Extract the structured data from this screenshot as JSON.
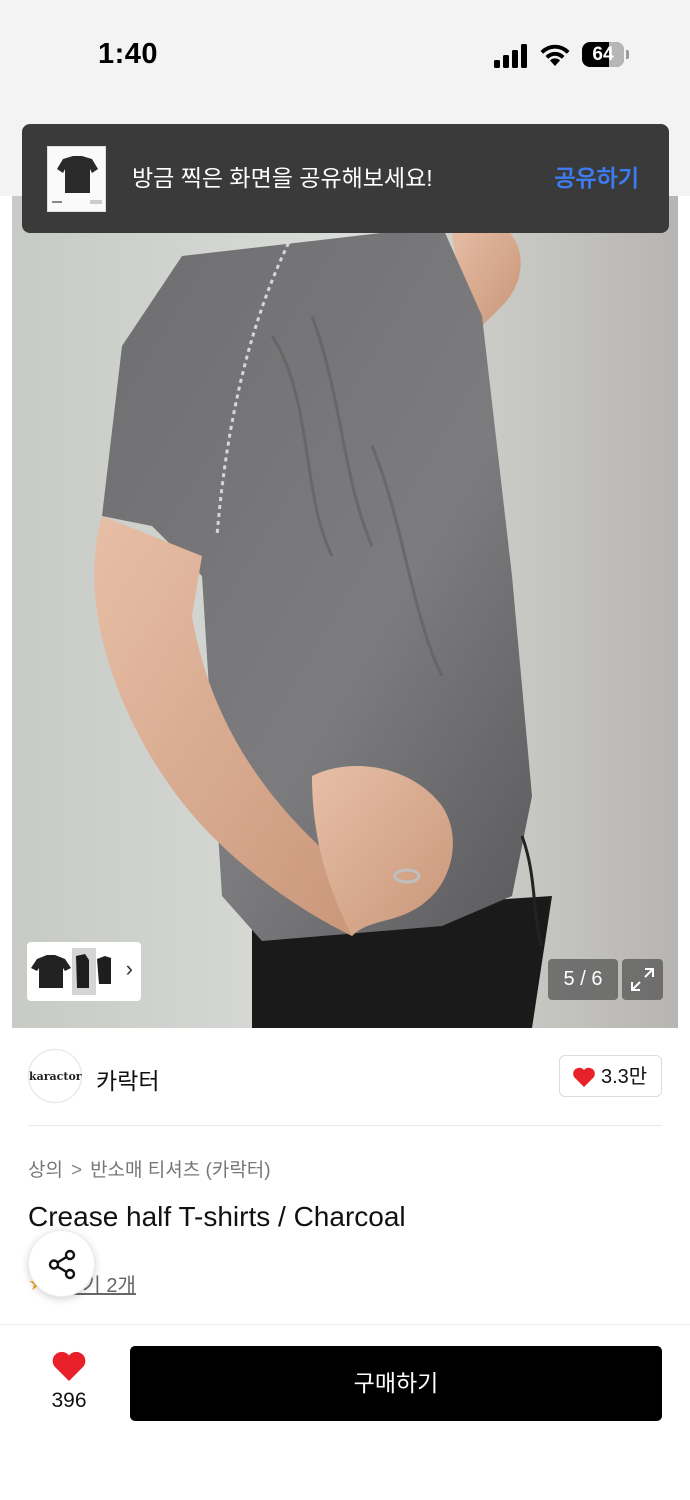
{
  "status_bar": {
    "time": "1:40",
    "battery": "64",
    "battery_level": 0.64
  },
  "toast": {
    "message": "방금 찍은 화면을 공유해보세요!",
    "action": "공유하기"
  },
  "gallery": {
    "counter": "5 / 6",
    "current_index": 5,
    "total": 6
  },
  "brand": {
    "logo_text": "karactor",
    "name": "카락터",
    "likes": "3.3만"
  },
  "breadcrumb": {
    "category": "상의",
    "subcategory": "반소매 티셔츠 (카락터)"
  },
  "product": {
    "title": "Crease half T-shirts / Charcoal",
    "reviews_label": "후기 2개"
  },
  "bottom_bar": {
    "wish_count": "396",
    "buy_label": "구매하기"
  },
  "colors": {
    "accent_blue": "#3d7bf0",
    "heart_red": "#e8202a",
    "buy_button": "#000000"
  },
  "icons": {
    "share": "share-icon",
    "expand": "expand-icon",
    "heart": "heart-icon",
    "chevron": "chevron-right-icon"
  }
}
